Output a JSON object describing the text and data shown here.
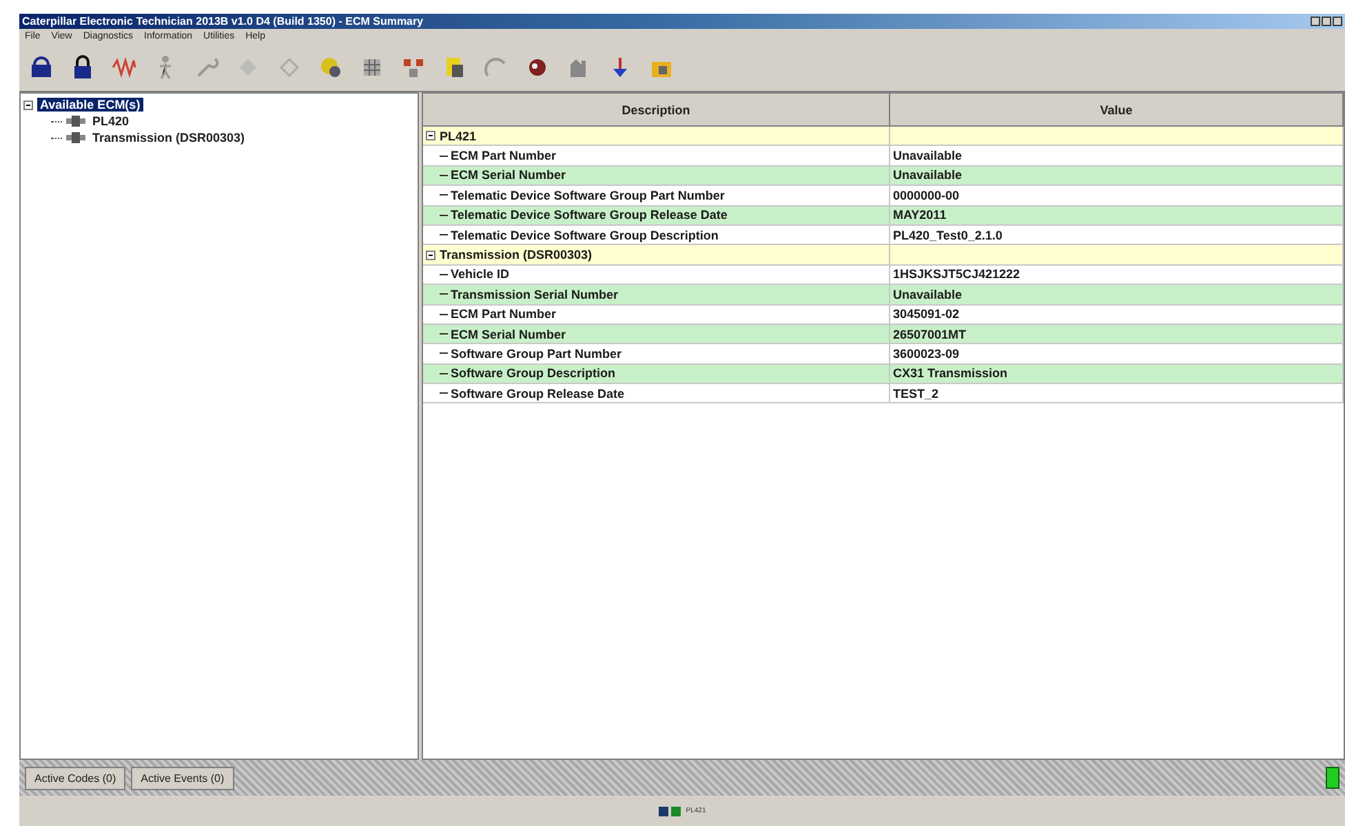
{
  "window": {
    "title": "Caterpillar Electronic Technician 2013B v1.0 D4 (Build 1350) - ECM Summary"
  },
  "menu": [
    "File",
    "View",
    "Diagnostics",
    "Information",
    "Utilities",
    "Help"
  ],
  "tree": {
    "label": "Available ECM(s)",
    "selected": true,
    "expanded": true,
    "children": [
      {
        "label": "PL420",
        "selected": false
      },
      {
        "label": "Transmission (DSR00303)",
        "selected": false
      }
    ]
  },
  "table": {
    "columns": [
      "Description",
      "Value"
    ],
    "groups": [
      {
        "label": "PL421",
        "expanded": true,
        "rows": [
          {
            "description": "ECM Part Number",
            "value": "Unavailable"
          },
          {
            "description": "ECM Serial Number",
            "value": "Unavailable"
          },
          {
            "description": "Telematic Device Software Group Part Number",
            "value": "0000000-00"
          },
          {
            "description": "Telematic Device Software Group Release Date",
            "value": "MAY2011"
          },
          {
            "description": "Telematic Device Software Group Description",
            "value": "PL420_Test0_2.1.0"
          }
        ]
      },
      {
        "label": "Transmission (DSR00303)",
        "expanded": true,
        "rows": [
          {
            "description": "Vehicle ID",
            "value": "1HSJKSJT5CJ421222"
          },
          {
            "description": "Transmission Serial Number",
            "value": "Unavailable"
          },
          {
            "description": "ECM Part Number",
            "value": "3045091-02"
          },
          {
            "description": "ECM Serial Number",
            "value": "26507001MT"
          },
          {
            "description": "Software Group Part Number",
            "value": "3600023-09"
          },
          {
            "description": "Software Group Description",
            "value": "CX31 Transmission"
          },
          {
            "description": "Software Group Release Date",
            "value": "TEST_2"
          }
        ]
      }
    ]
  },
  "bottom_tabs": [
    "Active Codes (0)",
    "Active Events (0)"
  ],
  "status_bar": {
    "label": "PL421"
  }
}
